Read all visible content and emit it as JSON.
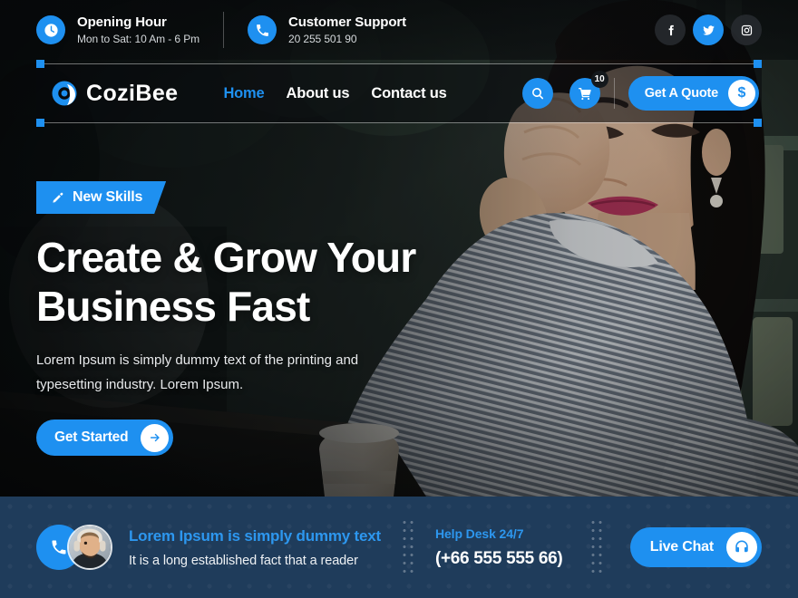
{
  "topbar": {
    "opening": {
      "icon": "clock-icon",
      "title": "Opening Hour",
      "subtitle": "Mon to Sat: 10 Am - 6 Pm"
    },
    "support": {
      "icon": "phone-icon",
      "title": "Customer Support",
      "subtitle": "20 255 501 90"
    },
    "socials": [
      {
        "name": "facebook",
        "glyph": "f",
        "active": false
      },
      {
        "name": "twitter",
        "glyph": "bird",
        "active": true
      },
      {
        "name": "instagram",
        "glyph": "camera",
        "active": false
      }
    ]
  },
  "nav": {
    "brand": "CoziBee",
    "menu": [
      {
        "label": "Home",
        "active": true
      },
      {
        "label": "About us",
        "active": false
      },
      {
        "label": "Contact us",
        "active": false
      }
    ],
    "search_icon": "search-icon",
    "cart_icon": "cart-icon",
    "cart_count": "10",
    "quote_label": "Get A Quote",
    "quote_symbol": "$"
  },
  "hero": {
    "badge_icon": "pencil-icon",
    "badge_label": "New Skills",
    "title_line1": "Create & Grow Your",
    "title_line2": "Business Fast",
    "paragraph": "Lorem Ipsum is simply dummy text of the printing and typesetting industry. Lorem Ipsum.",
    "cta_label": "Get Started",
    "cta_icon": "arrow-right-icon"
  },
  "bottombar": {
    "phone_icon": "phone-icon",
    "avatar": "support-agent-avatar",
    "headline": "Lorem Ipsum is simply dummy text",
    "subline": "It is a long established fact that a reader",
    "helpdesk_title": "Help Desk 24/7",
    "helpdesk_number": "(+66 555 555 66)",
    "livechat_label": "Live Chat",
    "livechat_icon": "headset-icon"
  },
  "colors": {
    "accent": "#1e90f0",
    "bottombar_bg": "#1f3c5b",
    "dark": "#14181c",
    "white": "#ffffff"
  }
}
